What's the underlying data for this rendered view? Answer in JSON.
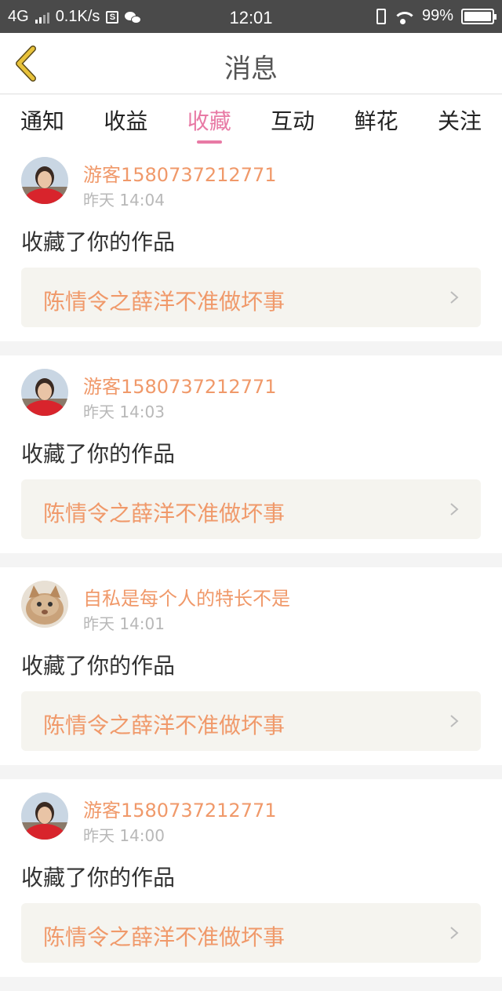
{
  "status": {
    "network": "4G",
    "speed": "0.1K/s",
    "time": "12:01",
    "battery": "99%",
    "battery_level": 0.99
  },
  "header": {
    "title": "消息"
  },
  "tabs": [
    {
      "label": "通知"
    },
    {
      "label": "收益"
    },
    {
      "label": "收藏",
      "active": true
    },
    {
      "label": "互动"
    },
    {
      "label": "鲜花"
    },
    {
      "label": "关注"
    }
  ],
  "items": [
    {
      "user": "游客1580737212771",
      "time": "昨天 14:04",
      "action": "收藏了你的作品",
      "work": "陈情令之薛洋不准做坏事",
      "avatar": "girl-avatar"
    },
    {
      "user": "游客1580737212771",
      "time": "昨天 14:03",
      "action": "收藏了你的作品",
      "work": "陈情令之薛洋不准做坏事",
      "avatar": "girl-avatar"
    },
    {
      "user": "自私是每个人的特长不是",
      "time": "昨天 14:01",
      "action": "收藏了你的作品",
      "work": "陈情令之薛洋不准做坏事",
      "avatar": "cat-avatar"
    },
    {
      "user": "游客1580737212771",
      "time": "昨天 14:00",
      "action": "收藏了你的作品",
      "work": "陈情令之薛洋不准做坏事",
      "avatar": "girl-avatar"
    }
  ],
  "colors": {
    "accent": "#e87aa5",
    "username": "#f0996a",
    "back_arrow": "#e8c23a"
  }
}
